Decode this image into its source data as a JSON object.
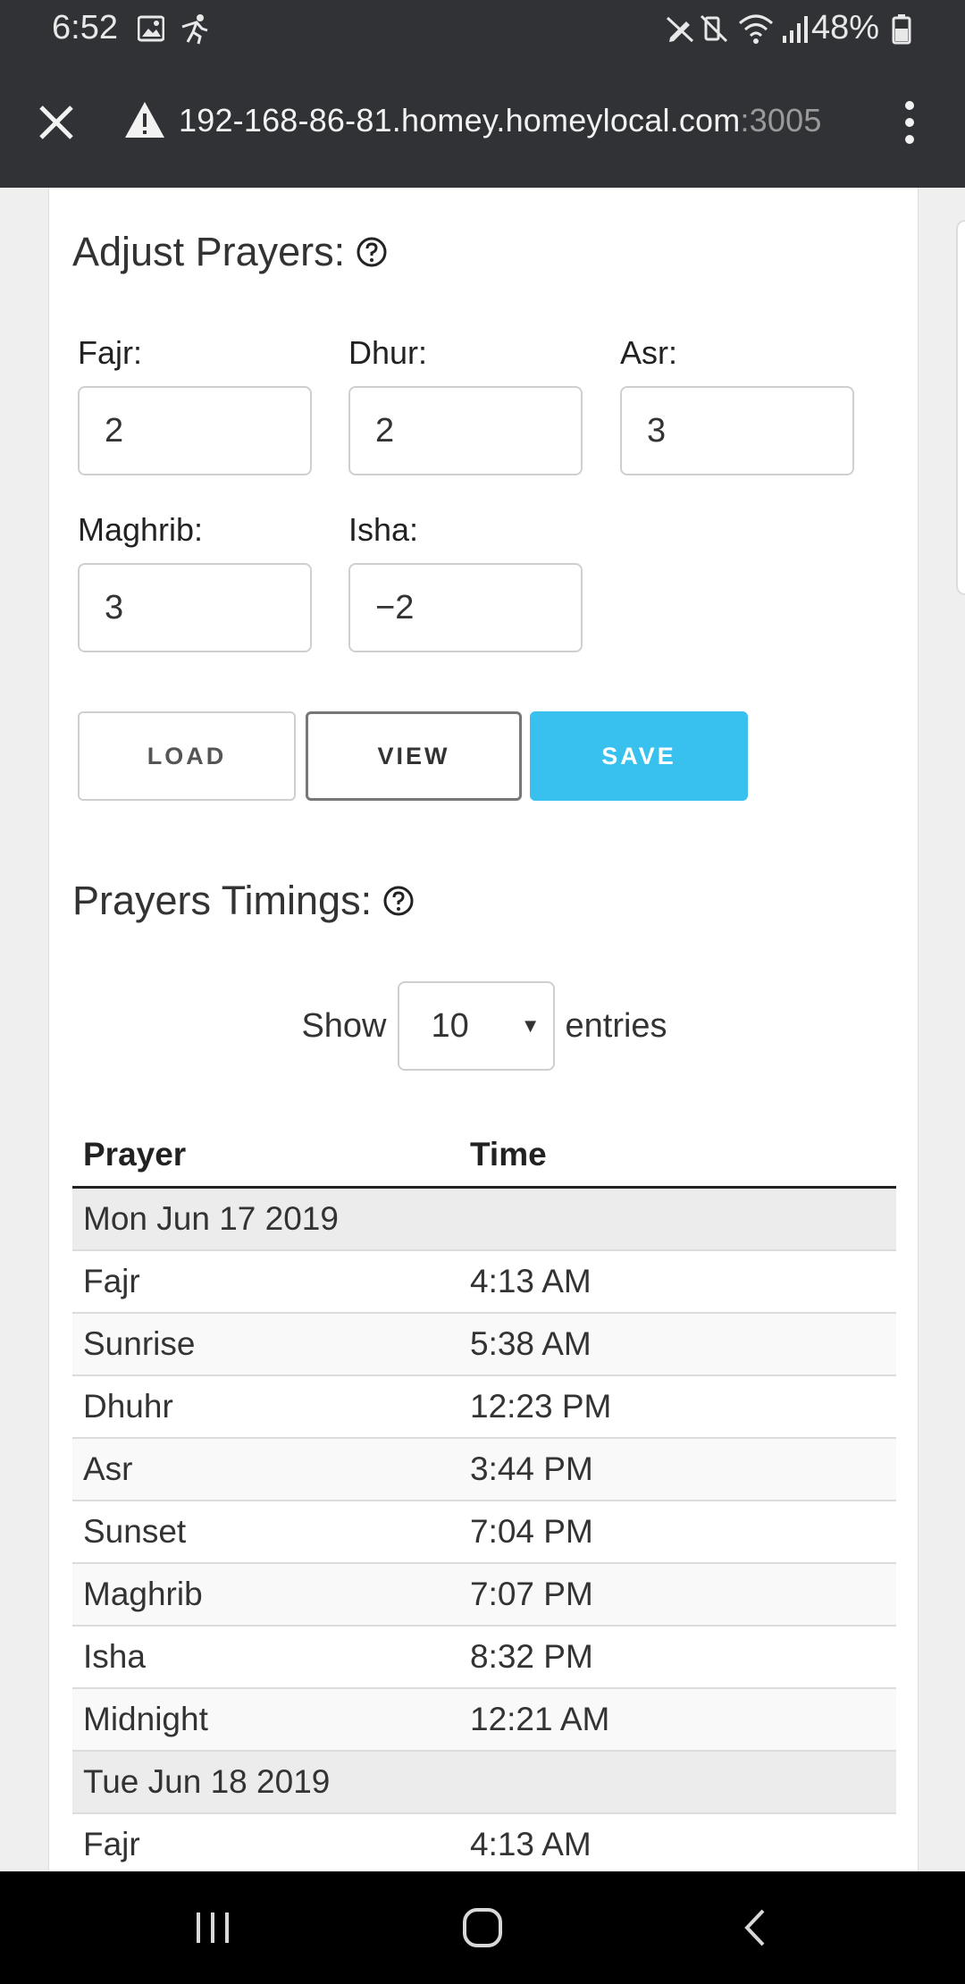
{
  "status_bar": {
    "time": "6:52",
    "battery": "48%",
    "left_icons": [
      "image-icon",
      "activity-icon"
    ],
    "right_icons": [
      "no-edit-icon",
      "mute-icon",
      "wifi-icon",
      "signal-icon",
      "battery-icon"
    ]
  },
  "browser": {
    "url_host": "192-168-86-81.homey.homeylocal.com",
    "url_port": ":3005"
  },
  "adjust": {
    "title": "Adjust Prayers:",
    "fields": {
      "fajr": {
        "label": "Fajr:",
        "value": "2"
      },
      "dhur": {
        "label": "Dhur:",
        "value": "2"
      },
      "asr": {
        "label": "Asr:",
        "value": "3"
      },
      "maghrib": {
        "label": "Maghrib:",
        "value": "3"
      },
      "isha": {
        "label": "Isha:",
        "value": "−2"
      }
    },
    "buttons": {
      "load": "LOAD",
      "view": "VIEW",
      "save": "SAVE"
    }
  },
  "timings": {
    "title": "Prayers Timings:",
    "show_label": "Show",
    "entries_value": "10",
    "entries_label": "entries",
    "columns": {
      "prayer": "Prayer",
      "time": "Time"
    },
    "rows": [
      {
        "group": "Mon Jun 17 2019"
      },
      {
        "prayer": "Fajr",
        "time": "4:13 AM"
      },
      {
        "prayer": "Sunrise",
        "time": "5:38 AM"
      },
      {
        "prayer": "Dhuhr",
        "time": "12:23 PM"
      },
      {
        "prayer": "Asr",
        "time": "3:44 PM"
      },
      {
        "prayer": "Sunset",
        "time": "7:04 PM"
      },
      {
        "prayer": "Maghrib",
        "time": "7:07 PM"
      },
      {
        "prayer": "Isha",
        "time": "8:32 PM"
      },
      {
        "prayer": "Midnight",
        "time": "12:21 AM"
      },
      {
        "group": "Tue Jun 18 2019"
      },
      {
        "prayer": "Fajr",
        "time": "4:13 AM"
      }
    ]
  },
  "colors": {
    "save_button": "#38c1ee",
    "chrome_bar": "#303236"
  }
}
